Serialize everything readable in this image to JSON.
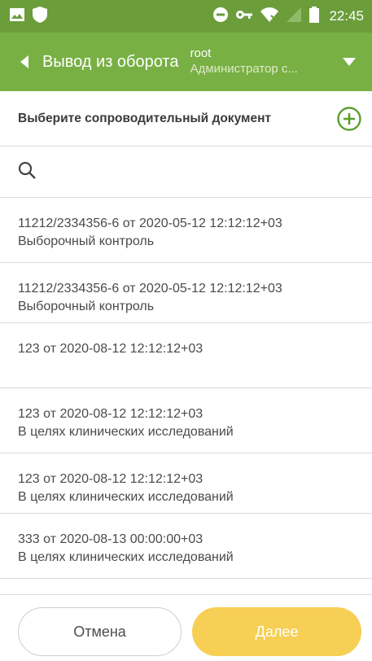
{
  "status_bar": {
    "time": "22:45",
    "icons": [
      "image-icon",
      "shield-icon",
      "do-not-disturb-icon",
      "key-icon",
      "wifi-icon",
      "no-sim-icon",
      "battery-icon"
    ]
  },
  "app_bar": {
    "title": "Вывод из оборота",
    "user_name": "root",
    "user_role": "Администратор с..."
  },
  "select_section": {
    "title": "Выберите сопроводительный документ"
  },
  "search": {
    "placeholder": "",
    "value": ""
  },
  "documents": [
    {
      "line1": "11212/2334356-6 от 2020-05-12 12:12:12+03",
      "line2": "Выборочный контроль"
    },
    {
      "line1": "11212/2334356-6 от 2020-05-12 12:12:12+03",
      "line2": "Выборочный контроль"
    },
    {
      "line1": "123 от 2020-08-12 12:12:12+03",
      "line2": ""
    },
    {
      "line1": "123 от 2020-08-12 12:12:12+03",
      "line2": "В целях клинических исследований"
    },
    {
      "line1": "123 от 2020-08-12 12:12:12+03",
      "line2": "В целях клинических исследований"
    },
    {
      "line1": "333 от 2020-08-13 00:00:00+03",
      "line2": "В целях клинических исследований"
    }
  ],
  "buttons": {
    "cancel": "Отмена",
    "next": "Далее"
  },
  "colors": {
    "status_bar": "#6b9d3b",
    "app_bar": "#78b044",
    "accent_green": "#5aa02c",
    "next_button": "#f6cf54"
  }
}
